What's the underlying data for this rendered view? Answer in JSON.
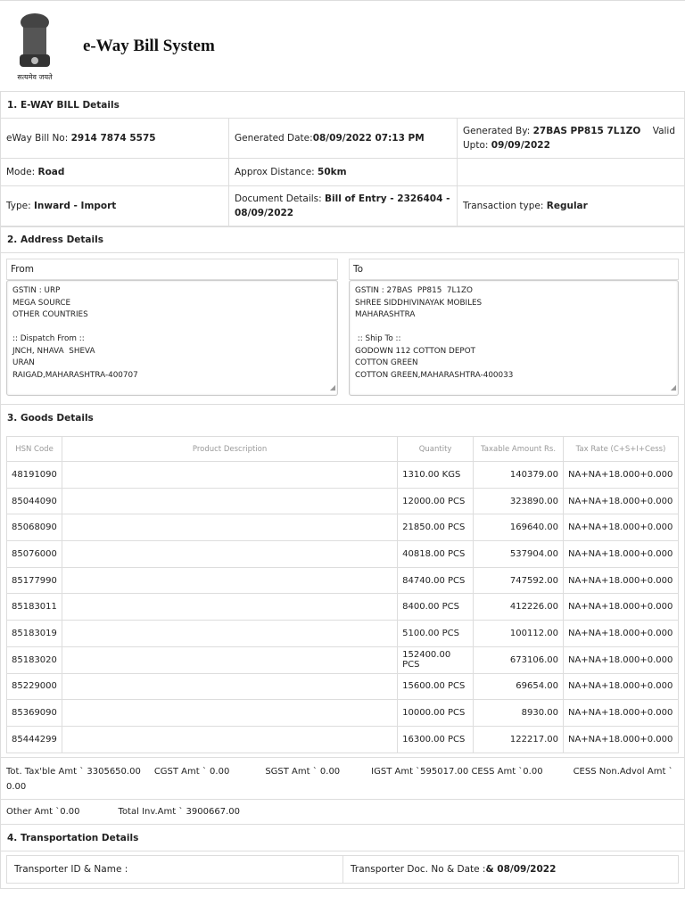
{
  "header": {
    "title": "e-Way Bill System",
    "emblem_motto": "सत्यमेव जयते"
  },
  "section1": {
    "title": "1.  E-WAY BILL Details",
    "eway_bill_no_label": "eWay Bill No: ",
    "eway_bill_no": "2914 7874 5575",
    "generated_date_label": "Generated Date:",
    "generated_date": "08/09/2022 07:13 PM",
    "generated_by_label": "Generated By: ",
    "generated_by": "27BAS PP815 7L1ZO",
    "valid_upto_label": "Valid Upto:",
    "valid_upto": "09/09/2022",
    "mode_label": "Mode: ",
    "mode": "Road",
    "distance_label": "Approx Distance: ",
    "distance": "50km",
    "type_label": "Type: ",
    "type": "Inward - Import",
    "document_label": "Document Details: ",
    "document": "Bill of Entry - 2326404 - 08/09/2022",
    "transaction_label": "Transaction type: ",
    "transaction": "Regular"
  },
  "section2": {
    "title": "2. Address Details",
    "from_label": "From",
    "to_label": "To",
    "from_text": "GSTIN : URP\nMEGA SOURCE\nOTHER COUNTRIES\n\n:: Dispatch From ::\nJNCH, NHAVA  SHEVA\nURAN\nRAIGAD,MAHARASHTRA-400707",
    "to_text": "GSTIN : 27BAS  PP815  7L1ZO\nSHREE SIDDHIVINAYAK MOBILES\nMAHARASHTRA\n\n :: Ship To ::\nGODOWN 112 COTTON DEPOT\nCOTTON GREEN\nCOTTON GREEN,MAHARASHTRA-400033"
  },
  "section3": {
    "title": "3.  Goods Details",
    "columns": [
      "HSN Code",
      "Product Description",
      "Quantity",
      "Taxable Amount Rs.",
      "Tax Rate (C+S+I+Cess)"
    ],
    "rows": [
      [
        "48191090",
        "",
        "1310.00 KGS",
        "140379.00",
        "NA+NA+18.000+0.000"
      ],
      [
        "85044090",
        "",
        "12000.00 PCS",
        "323890.00",
        "NA+NA+18.000+0.000"
      ],
      [
        "85068090",
        "",
        "21850.00 PCS",
        "169640.00",
        "NA+NA+18.000+0.000"
      ],
      [
        "85076000",
        "",
        "40818.00 PCS",
        "537904.00",
        "NA+NA+18.000+0.000"
      ],
      [
        "85177990",
        "",
        "84740.00 PCS",
        "747592.00",
        "NA+NA+18.000+0.000"
      ],
      [
        "85183011",
        "",
        "8400.00 PCS",
        "412226.00",
        "NA+NA+18.000+0.000"
      ],
      [
        "85183019",
        "",
        "5100.00 PCS",
        "100112.00",
        "NA+NA+18.000+0.000"
      ],
      [
        "85183020",
        "",
        "152400.00 PCS",
        "673106.00",
        "NA+NA+18.000+0.000"
      ],
      [
        "85229000",
        "",
        "15600.00 PCS",
        "69654.00",
        "NA+NA+18.000+0.000"
      ],
      [
        "85369090",
        "",
        "10000.00 PCS",
        "8930.00",
        "NA+NA+18.000+0.000"
      ],
      [
        "85444299",
        "",
        "16300.00 PCS",
        "122217.00",
        "NA+NA+18.000+0.000"
      ]
    ],
    "tot_taxable": "Tot. Tax'ble Amt ` 3305650.00",
    "cgst": "CGST Amt ` 0.00",
    "sgst": "SGST Amt ` 0.00",
    "igst": "IGST Amt `595017.00",
    "cess": "CESS Amt `0.00",
    "cess_nonadvol": "CESS Non.Advol Amt `",
    "cess_nonadvol_value": "0.00",
    "other_amt": "Other Amt `0.00",
    "total_inv": "Total Inv.Amt ` 3900667.00"
  },
  "section4": {
    "title": "4.  Transportation Details",
    "transporter_label": "Transporter ID & Name :",
    "doc_label": "Transporter Doc. No & Date : ",
    "doc_value": "& 08/09/2022"
  }
}
